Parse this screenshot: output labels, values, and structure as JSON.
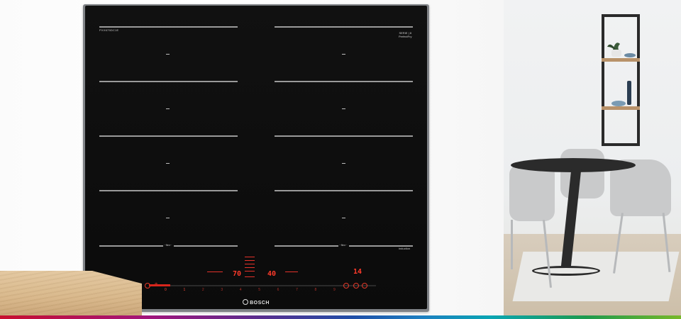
{
  "product": {
    "model_label": "PXX675DC1E",
    "series_label": "SERIE | 8",
    "series_sub": "PerfectFry",
    "brand": "BOSCH",
    "induction_label": "induction",
    "flex_label_left": "··flex··",
    "flex_label_right": "··flex··"
  },
  "controls": {
    "power_icon": "power-icon",
    "display_left": "70",
    "display_mid": "40",
    "display_timer": "14",
    "timer_unit": "min",
    "scale": [
      "0",
      "1",
      "2",
      "3",
      "4",
      "5",
      "6",
      "7",
      "8",
      "9"
    ]
  },
  "colors": {
    "accent_red": "#e4322a",
    "glass": "#0b0b0b",
    "frame": "#7f8286"
  }
}
